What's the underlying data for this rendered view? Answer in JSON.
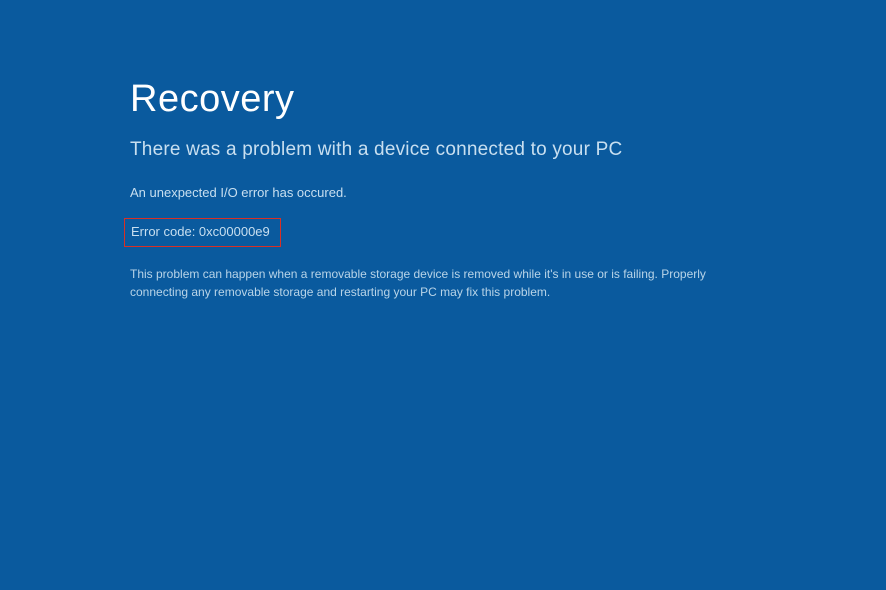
{
  "screen": {
    "title": "Recovery",
    "subtitle": "There was a problem with a device connected to your PC",
    "error_message": "An unexpected I/O error has occured.",
    "error_code": "Error code: 0xc00000e9",
    "description": "This problem can happen when a removable storage device is removed while it's in use or is failing. Properly connecting any removable storage and restarting your PC may fix this problem."
  },
  "highlight": {
    "border_color": "#d93025"
  },
  "colors": {
    "background": "#0a5a9e",
    "text_primary": "#ffffff",
    "text_secondary": "#c8dff0"
  }
}
